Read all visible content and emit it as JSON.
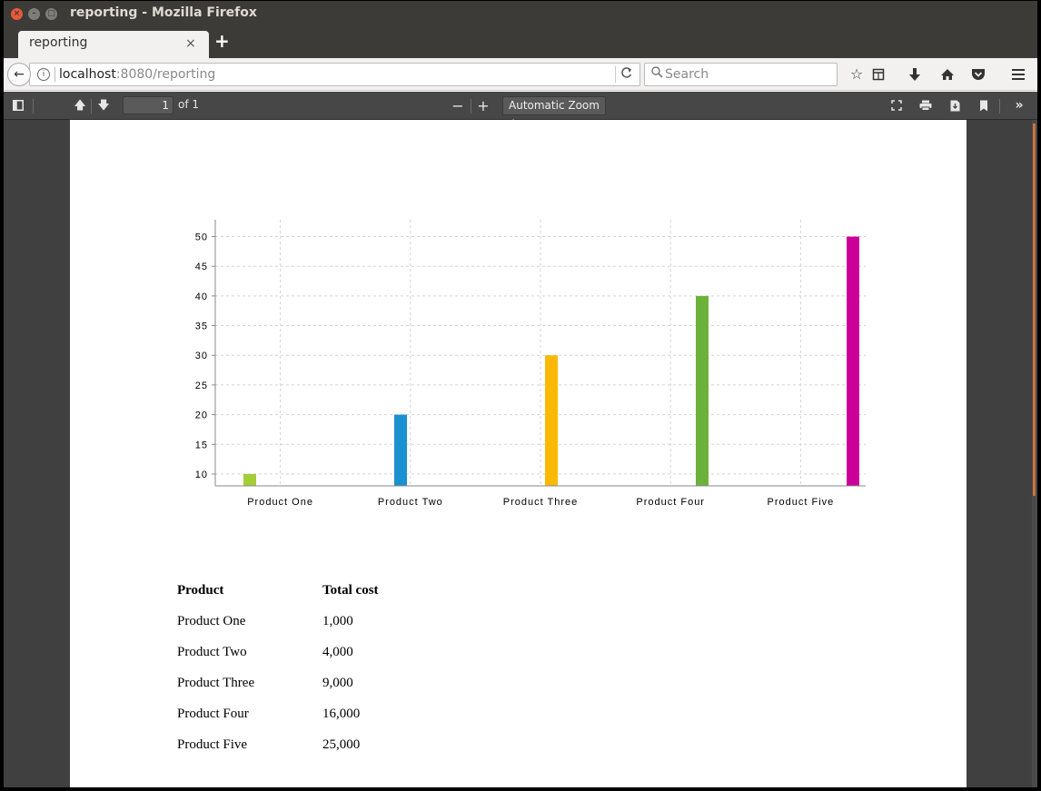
{
  "window": {
    "title": "reporting - Mozilla Firefox"
  },
  "tabs": [
    {
      "label": "reporting",
      "close_glyph": "×"
    }
  ],
  "new_tab_glyph": "+",
  "navbar": {
    "back_glyph": "←",
    "url_host": "localhost",
    "url_rest": ":8080/reporting",
    "reload_glyph": "C",
    "search_placeholder": "Search",
    "icons": [
      "bookmark-star-icon",
      "reading-list-icon",
      "download-icon",
      "home-icon",
      "pocket-icon",
      "menu-icon"
    ]
  },
  "pdf_toolbar": {
    "page_number": "1",
    "page_count": "of 1",
    "zoom_minus": "−",
    "zoom_plus": "+",
    "zoom_label": "Automatic Zoom  ≑"
  },
  "chart_data": {
    "type": "bar",
    "categories": [
      "Product One",
      "Product Two",
      "Product Three",
      "Product Four",
      "Product Five"
    ],
    "values": [
      10,
      20,
      30,
      40,
      50
    ],
    "colors": [
      "#a4cd39",
      "#1a91d0",
      "#f9b904",
      "#6cb23a",
      "#cc0099"
    ],
    "ylim": [
      8,
      51
    ],
    "yticks": [
      10,
      15,
      20,
      25,
      30,
      35,
      40,
      45,
      50
    ],
    "grid": true
  },
  "table": {
    "headers": [
      "Product",
      "Total cost"
    ],
    "rows": [
      [
        "Product One",
        "1,000"
      ],
      [
        "Product Two",
        "4,000"
      ],
      [
        "Product Three",
        "9,000"
      ],
      [
        "Product Four",
        "16,000"
      ],
      [
        "Product Five",
        "25,000"
      ]
    ]
  }
}
